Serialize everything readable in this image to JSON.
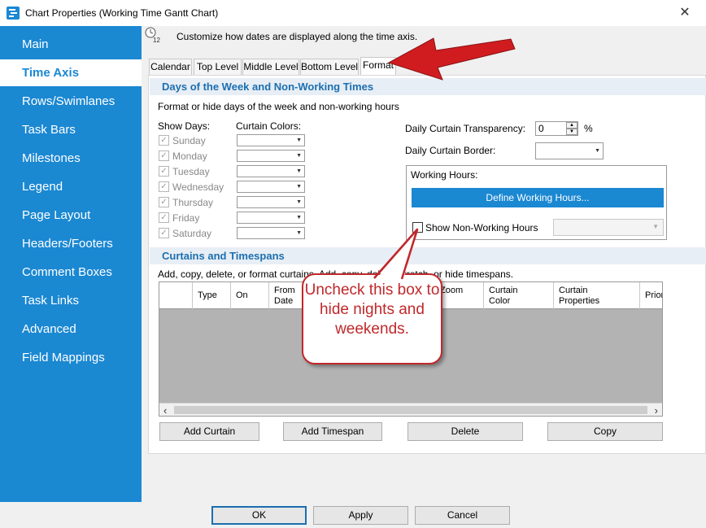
{
  "window": {
    "title": "Chart Properties (Working Time Gantt Chart)",
    "close_glyph": "✕"
  },
  "sidebar": {
    "items": [
      {
        "label": "Main"
      },
      {
        "label": "Time Axis"
      },
      {
        "label": "Rows/Swimlanes"
      },
      {
        "label": "Task Bars"
      },
      {
        "label": "Milestones"
      },
      {
        "label": "Legend"
      },
      {
        "label": "Page Layout"
      },
      {
        "label": "Headers/Footers"
      },
      {
        "label": "Comment Boxes"
      },
      {
        "label": "Task Links"
      },
      {
        "label": "Advanced"
      },
      {
        "label": "Field Mappings"
      }
    ],
    "active": "Time Axis"
  },
  "header": {
    "text": "Customize how dates are displayed along the time axis.",
    "icon_number": "12"
  },
  "tabs": [
    {
      "label": "Calendar"
    },
    {
      "label": "Top Level"
    },
    {
      "label": "Middle Level"
    },
    {
      "label": "Bottom Level"
    },
    {
      "label": "Format"
    }
  ],
  "days_section": {
    "title": "Days of the Week and Non-Working Times",
    "description": "Format or hide days of the week and non-working hours",
    "show_days_label": "Show Days:",
    "curtain_colors_label": "Curtain Colors:",
    "days": [
      "Sunday",
      "Monday",
      "Tuesday",
      "Wednesday",
      "Thursday",
      "Friday",
      "Saturday"
    ],
    "check_glyph": "✓",
    "transparency_label": "Daily Curtain Transparency:",
    "transparency_value": "0",
    "transparency_unit": "%",
    "border_label": "Daily Curtain Border:",
    "working_hours_label": "Working Hours:",
    "define_button": "Define Working Hours...",
    "show_nonworking_label": "Show Non-Working Hours"
  },
  "curtains_section": {
    "title": "Curtains and Timespans",
    "description": "Add, copy, delete, or format curtains.  Add, copy, delete, stretch, or hide timespans.",
    "columns": [
      "Type",
      "On",
      "From\nDate",
      "Zoom",
      "Curtain\nColor",
      "Curtain\nProperties",
      "Priori"
    ],
    "buttons": [
      "Add Curtain",
      "Add Timespan",
      "Delete",
      "Copy"
    ]
  },
  "footer": {
    "ok": "OK",
    "apply": "Apply",
    "cancel": "Cancel"
  },
  "callout": {
    "text": "Uncheck this box to hide nights and weekends."
  },
  "colors": {
    "accent": "#1b88d2",
    "callout_red": "#c0282b",
    "arrow_red": "#d01c1f"
  }
}
